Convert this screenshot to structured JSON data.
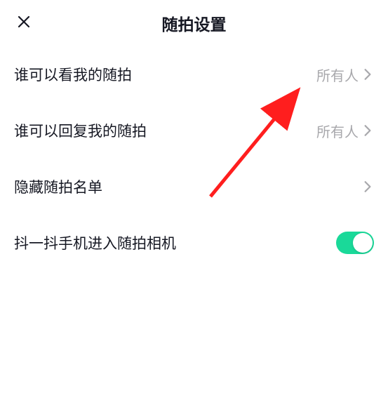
{
  "header": {
    "title": "随拍设置"
  },
  "rows": {
    "view": {
      "label": "谁可以看我的随拍",
      "value": "所有人"
    },
    "reply": {
      "label": "谁可以回复我的随拍",
      "value": "所有人"
    },
    "hidden": {
      "label": "隐藏随拍名单"
    },
    "shake": {
      "label": "抖一抖手机进入随拍相机",
      "toggle": true
    }
  },
  "colors": {
    "accent": "#1ad999",
    "text": "#161823",
    "muted": "#a8a8ac"
  }
}
